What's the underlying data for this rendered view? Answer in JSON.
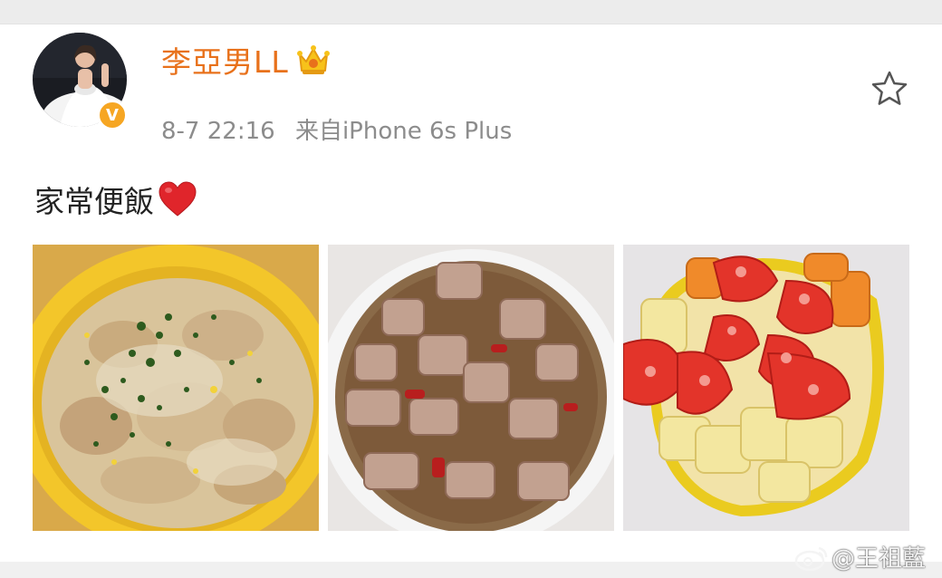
{
  "post": {
    "username": "李亞男LL",
    "time": "8-7 22:16",
    "source": "来自iPhone 6s Plus",
    "text": "家常便飯",
    "verified_badge": "V"
  },
  "images": [
    {
      "name": "creamy-chicken-dish-photo"
    },
    {
      "name": "braised-pork-ribs-photo"
    },
    {
      "name": "tomato-potato-carrot-photo"
    }
  ],
  "watermark": {
    "text": "@王祖藍"
  },
  "colors": {
    "username": "#e8711b",
    "meta": "#8c8c8c",
    "badge": "#f6a623",
    "heart": "#e0252b"
  },
  "icons": {
    "crown": "crown-icon",
    "star": "star-icon",
    "heart": "heart-icon",
    "weibo": "weibo-logo-icon"
  }
}
